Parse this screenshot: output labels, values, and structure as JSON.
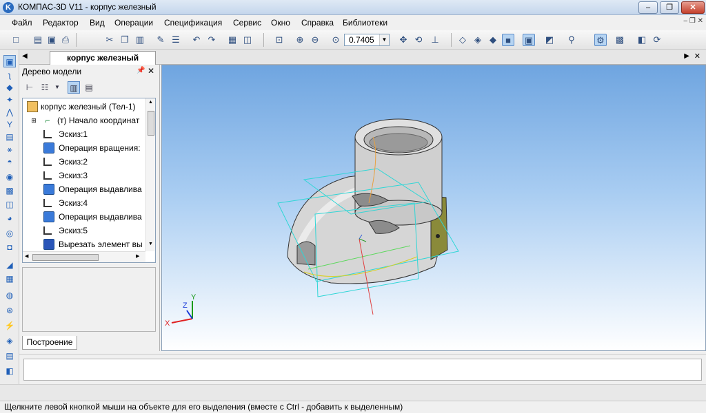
{
  "window": {
    "title": "КОМПАС-3D V11 - корпус железный",
    "icon_letter": "K",
    "controls": {
      "minimize": "‒",
      "maximize": "❐",
      "close": "✕"
    }
  },
  "menu": {
    "items": [
      "Файл",
      "Редактор",
      "Вид",
      "Операции",
      "Спецификация",
      "Сервис",
      "Окно",
      "Справка",
      "Библиотеки"
    ],
    "doc_controls": "‒ ❐ ✕"
  },
  "toolbar": {
    "zoom_value": "0.7405",
    "icons": [
      "new-icon",
      "open-icon",
      "save-icon",
      "print-icon",
      "cut-icon",
      "copy-icon",
      "paste-icon",
      "format-brush-icon",
      "properties-icon",
      "undo-icon",
      "redo-icon",
      "manager-icon",
      "variables-icon",
      "zoom-window-icon",
      "zoom-in-icon",
      "zoom-out-icon",
      "zoom-scale-icon",
      "pan-icon",
      "rotate-icon",
      "orientation-icon",
      "wireframe-icon",
      "hidden-lines-icon",
      "hidden-thin-icon",
      "halftone-icon",
      "halftone-edges-icon",
      "perspective-icon",
      "filter-icon",
      "snap-icon",
      "library-icon",
      "refresh-icon"
    ]
  },
  "document_tab": {
    "label": "корпус железный"
  },
  "model_tree": {
    "title": "Дерево модели",
    "bottom_tab": "Построение",
    "items": [
      {
        "label": "корпус железный (Тел-1)",
        "icon": "part-icon"
      },
      {
        "label": "(т) Начало координат",
        "icon": "origin-icon"
      },
      {
        "label": "Эскиз:1",
        "icon": "sketch-icon"
      },
      {
        "label": "Операция вращения:",
        "icon": "revolve-icon"
      },
      {
        "label": "Эскиз:2",
        "icon": "sketch-icon"
      },
      {
        "label": "Эскиз:3",
        "icon": "sketch-icon"
      },
      {
        "label": "Операция выдавлива",
        "icon": "extrude-icon"
      },
      {
        "label": "Эскиз:4",
        "icon": "sketch-icon"
      },
      {
        "label": "Операция выдавлива",
        "icon": "extrude-icon"
      },
      {
        "label": "Эскиз:5",
        "icon": "sketch-icon"
      },
      {
        "label": "Вырезать элемент вы",
        "icon": "cut-extrude-icon"
      }
    ]
  },
  "axes": {
    "x": "X",
    "y": "Y",
    "z": "Z"
  },
  "status": {
    "text": "Щелкните левой кнопкой мыши на объекте для его выделения (вместе с Ctrl - добавить к выделенным)"
  }
}
